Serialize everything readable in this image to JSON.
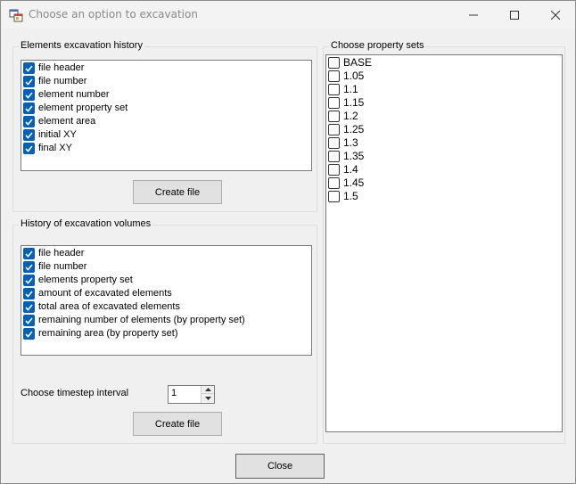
{
  "window": {
    "title": "Choose an option to excavation",
    "icon": "app-window-icon"
  },
  "elements_history": {
    "legend": "Elements excavation history",
    "items": [
      {
        "label": "file header",
        "checked": true
      },
      {
        "label": "file number",
        "checked": true
      },
      {
        "label": "element number",
        "checked": true
      },
      {
        "label": "element property set",
        "checked": true
      },
      {
        "label": "element area",
        "checked": true
      },
      {
        "label": "initial XY",
        "checked": true
      },
      {
        "label": "final XY",
        "checked": true
      }
    ],
    "create_label": "Create file"
  },
  "volumes_history": {
    "legend": "History of excavation volumes",
    "items": [
      {
        "label": "file header",
        "checked": true
      },
      {
        "label": "file number",
        "checked": true
      },
      {
        "label": "elements property set",
        "checked": true
      },
      {
        "label": "amount of excavated elements",
        "checked": true
      },
      {
        "label": "total area of excavated elements",
        "checked": true
      },
      {
        "label": "remaining number of elements (by property set)",
        "checked": true
      },
      {
        "label": "remaining area (by property set)",
        "checked": true
      }
    ],
    "timestep_label": "Choose timestep interval",
    "timestep_value": "1",
    "create_label": "Create file"
  },
  "property_sets": {
    "legend": "Choose property sets",
    "items": [
      {
        "label": "BASE",
        "checked": false
      },
      {
        "label": "1.05",
        "checked": false
      },
      {
        "label": "1.1",
        "checked": false
      },
      {
        "label": "1.15",
        "checked": false
      },
      {
        "label": "1.2",
        "checked": false
      },
      {
        "label": "1.25",
        "checked": false
      },
      {
        "label": "1.3",
        "checked": false
      },
      {
        "label": "1.35",
        "checked": false
      },
      {
        "label": "1.4",
        "checked": false
      },
      {
        "label": "1.45",
        "checked": false
      },
      {
        "label": "1.5",
        "checked": false
      }
    ]
  },
  "footer": {
    "close_label": "Close"
  },
  "colors": {
    "checkbox_accent": "#005fb8",
    "window_bg": "#f0f0f0"
  }
}
